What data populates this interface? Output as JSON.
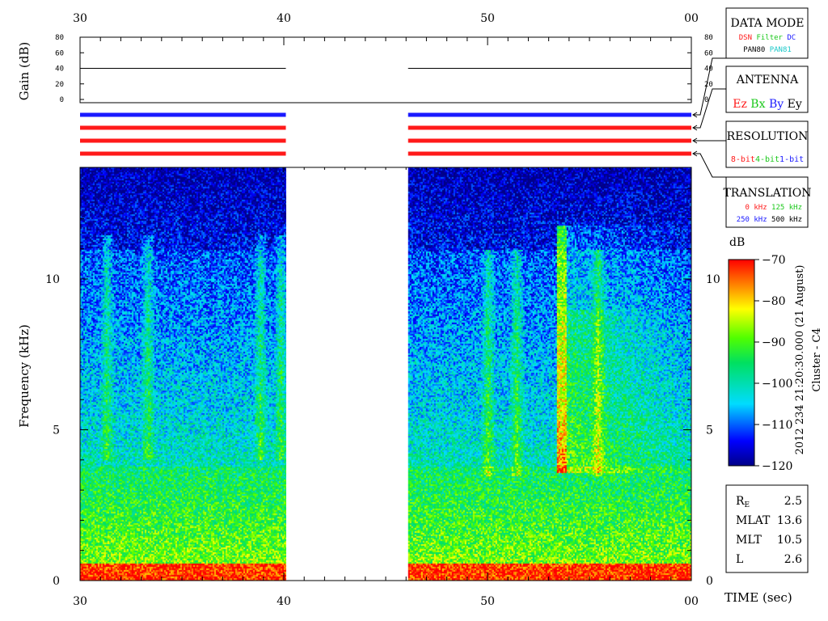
{
  "chart_data": {
    "type": "heatmap",
    "xlabel": "TIME (sec)",
    "ylabel": "Frequency (kHz)",
    "gain_label": "Gain (dB)",
    "x_tick_labels": [
      "30",
      "40",
      "50",
      "00"
    ],
    "x_range_sec": [
      30,
      60
    ],
    "data_gap_sec": [
      40.1,
      46.1
    ],
    "y_ticks_khz": [
      0,
      5,
      10
    ],
    "y_range_khz": [
      0,
      13.7
    ],
    "gain_ticks_db": [
      0,
      20,
      40,
      60,
      80
    ],
    "gain_range_db": [
      0,
      80
    ],
    "gain_level_db": 40,
    "colorbar": {
      "title": "dB",
      "ticks": [
        -70,
        -80,
        -90,
        -100,
        -110,
        -120
      ],
      "range": [
        -120,
        -70
      ]
    },
    "mode_bar_colors": [
      "#1a1aff",
      "#ff1a1a",
      "#ff1a1a",
      "#ff1a1a"
    ],
    "features": {
      "low_freq_band_khz": [
        0,
        0.6
      ],
      "emission_band_khz": [
        0.6,
        3.8
      ],
      "strong_burst_time_sec": 53.6
    },
    "side_label": "2012 234 21:20:30.000 (21 August)",
    "side_label2": "Cluster - C4"
  },
  "legend_boxes": {
    "data_mode": {
      "title": "DATA MODE",
      "row1": [
        {
          "text": "DSN",
          "color": "#ff1a1a"
        },
        {
          "text": "Filter",
          "color": "#19c819"
        },
        {
          "text": "DC",
          "color": "#1a1aff"
        }
      ],
      "row2": [
        {
          "text": "PAN80",
          "color": "#000000"
        },
        {
          "text": "PAN81",
          "color": "#19c8c8"
        }
      ]
    },
    "antenna": {
      "title": "ANTENNA",
      "items": [
        {
          "text": "Ez",
          "color": "#ff1a1a"
        },
        {
          "text": "Bx",
          "color": "#19c819"
        },
        {
          "text": "By",
          "color": "#1a1aff"
        },
        {
          "text": "Ey",
          "color": "#000000"
        }
      ]
    },
    "resolution": {
      "title": "RESOLUTION",
      "items": [
        {
          "text": "8-bit",
          "color": "#ff1a1a"
        },
        {
          "text": "4-bit",
          "color": "#19c819"
        },
        {
          "text": "1-bit",
          "color": "#1a1aff"
        }
      ]
    },
    "translation": {
      "title": "TRANSLATION",
      "row1": [
        {
          "text": "0 kHz",
          "color": "#ff1a1a"
        },
        {
          "text": "125 kHz",
          "color": "#19c819"
        }
      ],
      "row2": [
        {
          "text": "250 kHz",
          "color": "#1a1aff"
        },
        {
          "text": "500 kHz",
          "color": "#000000"
        }
      ]
    }
  },
  "orbit": {
    "rows": [
      {
        "label": "R",
        "sub": "E",
        "value": "2.5"
      },
      {
        "label": "MLAT",
        "sub": "",
        "value": "13.6"
      },
      {
        "label": "MLT",
        "sub": "",
        "value": "10.5"
      },
      {
        "label": "L",
        "sub": "",
        "value": "2.6"
      }
    ]
  }
}
